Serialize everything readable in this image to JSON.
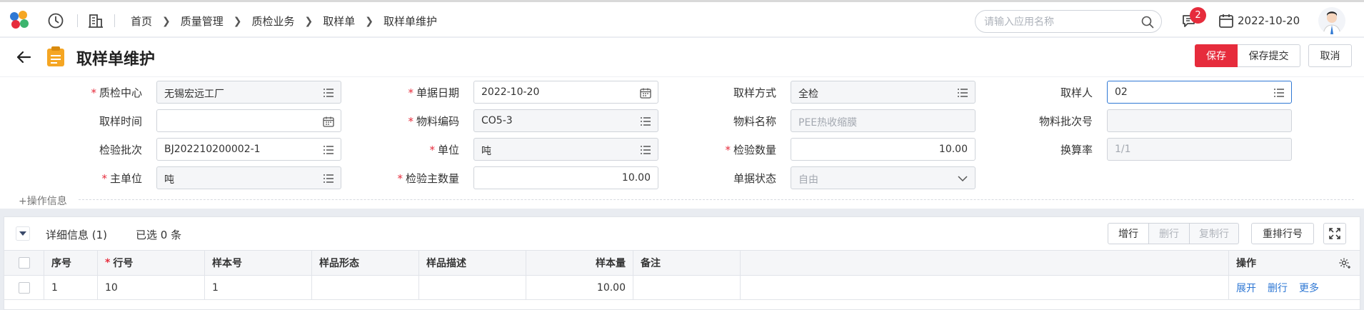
{
  "topbar": {
    "breadcrumb": [
      "首页",
      "质量管理",
      "质检业务",
      "取样单",
      "取样单维护"
    ],
    "search_placeholder": "请输入应用名称",
    "notification_count": "2",
    "date": "2022-10-20"
  },
  "header": {
    "title": "取样单维护",
    "save_label": "保存",
    "save_submit_label": "保存提交",
    "cancel_label": "取消"
  },
  "form": {
    "quality_center": {
      "label": "质检中心",
      "value": "无锡宏远工厂"
    },
    "doc_date": {
      "label": "单据日期",
      "value": "2022-10-20"
    },
    "sampling_method": {
      "label": "取样方式",
      "value": "全检"
    },
    "sampler": {
      "label": "取样人",
      "value": "02"
    },
    "sampling_time": {
      "label": "取样时间",
      "value": ""
    },
    "material_code": {
      "label": "物料编码",
      "value": "CO5-3"
    },
    "material_name": {
      "label": "物料名称",
      "value": "PEE热收缩膜"
    },
    "material_batch": {
      "label": "物料批次号",
      "value": ""
    },
    "inspection_batch": {
      "label": "检验批次",
      "value": "BJ202210200002-1"
    },
    "unit": {
      "label": "单位",
      "value": "吨"
    },
    "inspection_qty": {
      "label": "检验数量",
      "value": "10.00"
    },
    "conversion_rate": {
      "label": "换算率",
      "value": "1/1"
    },
    "main_unit": {
      "label": "主单位",
      "value": "吨"
    },
    "inspection_main_qty": {
      "label": "检验主数量",
      "value": "10.00"
    },
    "doc_status": {
      "label": "单据状态",
      "value": "自由"
    },
    "operation_info": "+操作信息"
  },
  "detail": {
    "title": "详细信息 (1)",
    "selected": "已选 0 条",
    "buttons": {
      "add_row": "增行",
      "delete_row": "删行",
      "copy_row": "复制行",
      "reorder": "重排行号"
    },
    "columns": [
      "序号",
      "行号",
      "样本号",
      "样品形态",
      "样品描述",
      "样本量",
      "备注",
      "操作"
    ],
    "rows": [
      {
        "seq": "1",
        "line_no": "10",
        "sample_no": "1",
        "form": "",
        "desc": "",
        "qty": "10.00",
        "remark": ""
      }
    ],
    "row_actions": [
      "展开",
      "删行",
      "更多"
    ]
  },
  "colors": {
    "accent": "#e62c3c",
    "link": "#2f78d4"
  }
}
